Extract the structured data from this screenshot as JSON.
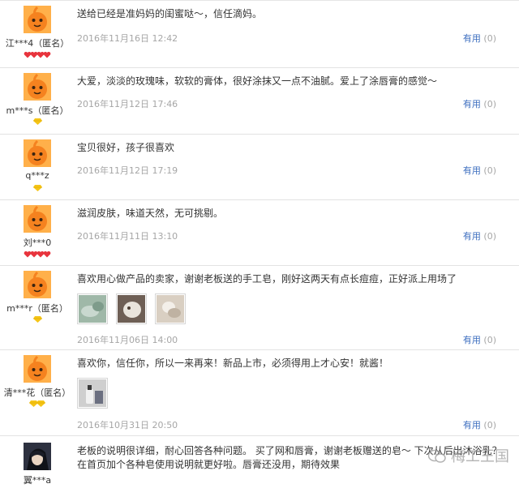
{
  "reviews": [
    {
      "user": "江***4（匿名）",
      "avatar": "orange-mascot-icon",
      "badge": "four-red-hearts",
      "content": "送给已经是准妈妈的闺蜜哒～，信任滴妈。",
      "date": "2016年11月16日 12:42",
      "useful_label": "有用",
      "useful_count": "(0)"
    },
    {
      "user": "m***s（匿名）",
      "avatar": "orange-mascot-icon",
      "badge": "one-yellow-diamond",
      "content": "大爱，淡淡的玫瑰味，软软的膏体，很好涂抹又一点不油腻。爱上了涂唇膏的感觉～",
      "date": "2016年11月12日 17:46",
      "useful_label": "有用",
      "useful_count": "(0)"
    },
    {
      "user": "q***z",
      "avatar": "orange-mascot-icon",
      "badge": "one-yellow-diamond",
      "content": "宝贝很好，孩子很喜欢",
      "date": "2016年11月12日 17:19",
      "useful_label": "有用",
      "useful_count": "(0)"
    },
    {
      "user": "刘***0",
      "avatar": "orange-mascot-icon",
      "badge": "four-red-hearts",
      "content": "滋润皮肤，味道天然，无可挑剔。",
      "date": "2016年11月11日 13:10",
      "useful_label": "有用",
      "useful_count": "(0)"
    },
    {
      "user": "m***r（匿名）",
      "avatar": "orange-mascot-icon",
      "badge": "one-yellow-diamond",
      "content": "喜欢用心做产品的卖家，谢谢老板送的手工皂，刚好这两天有点长痘痘，正好派上用场了",
      "date": "2016年11月06日 14:00",
      "useful_label": "有用",
      "useful_count": "(0)",
      "photos": [
        "photo-soap-1",
        "photo-soap-2",
        "photo-soap-3"
      ]
    },
    {
      "user": "清***花（匿名）",
      "avatar": "orange-mascot-icon",
      "badge": "two-yellow-diamonds",
      "content": "喜欢你，信任你，所以一来再来！新品上市，必须得用上才心安！就酱！",
      "date": "2016年10月31日 20:50",
      "useful_label": "有用",
      "useful_count": "(0)",
      "photos": [
        "photo-bottle"
      ]
    },
    {
      "user": "翼***a",
      "avatar": "anime-avatar-icon",
      "content": "老板的说明很详细，耐心回答各种问题。 买了网和唇膏，谢谢老板赠送的皂～ 下次从后出沐浴乳？在首页加个各种皂使用说明就更好啦。唇膏还没用，期待效果"
    }
  ],
  "watermark": "梅工王国",
  "colors": {
    "link": "#3b6dbf",
    "muted": "#a6a6a6",
    "divider": "#e3e3e3",
    "mascot": "#f5821f",
    "heart": "#e8343d",
    "diamond": "#f5c518"
  }
}
